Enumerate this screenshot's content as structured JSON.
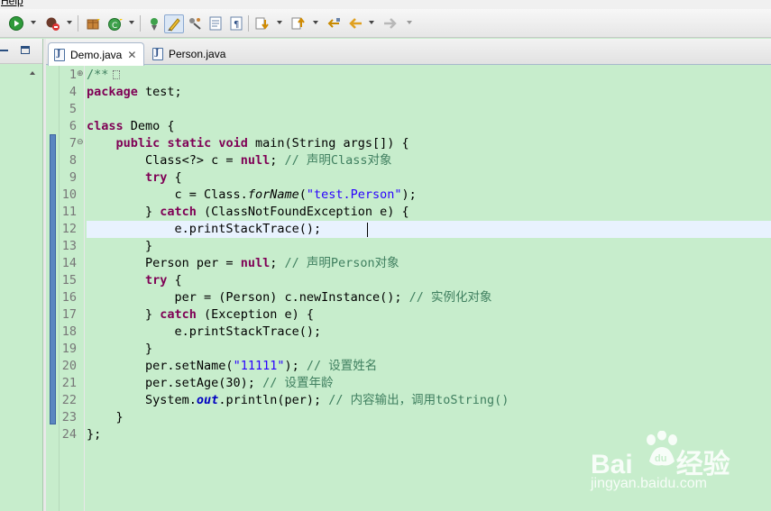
{
  "menu": {
    "help_label": "Help"
  },
  "toolbar": {
    "buttons": [
      "run-icon",
      "debug-run-icon",
      "new-java-package-icon",
      "new-class-icon",
      "open-type-icon",
      "toggle-mark-occurrences-icon",
      "toggle-breadcrumb-icon",
      "show-whitespace-icon",
      "block-selection-icon",
      "next-annotation-icon",
      "previous-annotation-icon",
      "last-edit-location-icon",
      "back-icon",
      "forward-icon"
    ]
  },
  "left_view": {
    "minimize_icon": "minimize-icon",
    "maximize_icon": "maximize-icon"
  },
  "tabs": [
    {
      "label": "Demo.java",
      "active": true,
      "close": "✕"
    },
    {
      "label": "Person.java",
      "active": false
    }
  ],
  "editor": {
    "line_numbers": [
      "1",
      "4",
      "5",
      "6",
      "7",
      "8",
      "9",
      "10",
      "11",
      "12",
      "13",
      "14",
      "15",
      "16",
      "17",
      "18",
      "19",
      "20",
      "21",
      "22",
      "23",
      "24"
    ],
    "current_line": "12",
    "folded_marker": "/**",
    "lines": [
      "/**",
      "package test;",
      "",
      "class Demo {",
      "    public static void main(String args[]) {",
      "        Class<?> c = null; // 声明Class对象",
      "        try {",
      "            c = Class.forName(\"test.Person\");",
      "        } catch (ClassNotFoundException e) {",
      "            e.printStackTrace();",
      "        }",
      "        Person per = null; // 声明Person对象",
      "        try {",
      "            per = (Person) c.newInstance(); // 实例化对象",
      "        } catch (Exception e) {",
      "            e.printStackTrace();",
      "        }",
      "        per.setName(\"11111\"); // 设置姓名",
      "        per.setAge(30); // 设置年龄",
      "        System.out.println(per); // 内容输出，调用toString()",
      "    }",
      "};"
    ],
    "colors": {
      "background": "#c7edcc",
      "keyword": "#7f0055",
      "comment": "#3f7f5f",
      "string": "#2a00ff",
      "field": "#0000c0",
      "current_line": "#e8f2fe"
    }
  },
  "watermark": {
    "logo_left": "Bai",
    "logo_right": "经验",
    "site": "jingyan.baidu.com"
  }
}
